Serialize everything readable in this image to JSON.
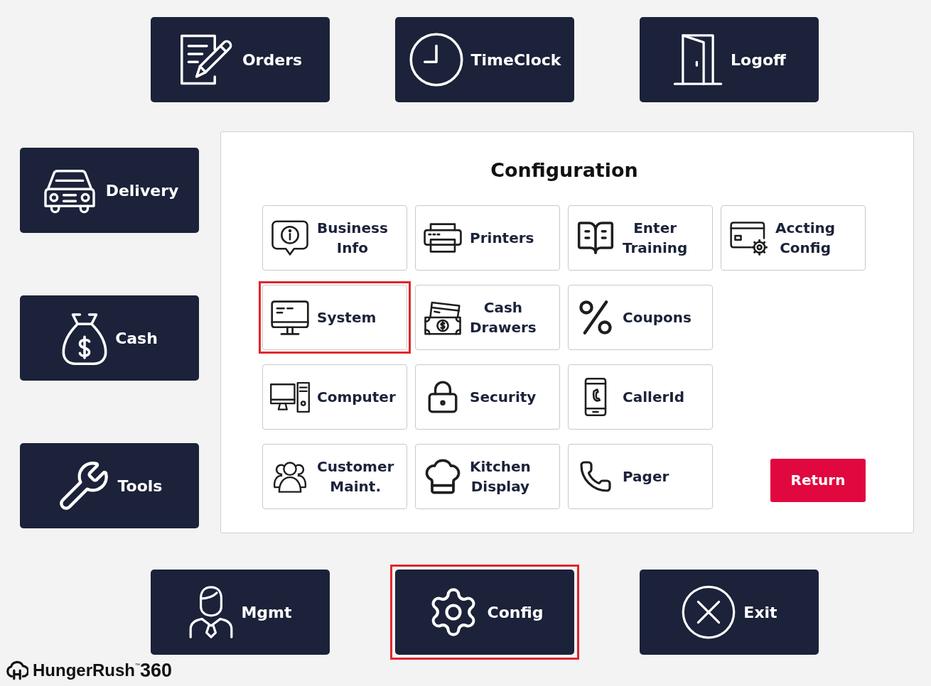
{
  "top_buttons": [
    {
      "label": "Orders"
    },
    {
      "label": "TimeClock"
    },
    {
      "label": "Logoff"
    }
  ],
  "side_buttons": [
    {
      "label": "Delivery"
    },
    {
      "label": "Cash"
    },
    {
      "label": "Tools"
    }
  ],
  "config_panel": {
    "title": "Configuration",
    "tile_rows": [
      [
        {
          "label": "Business Info",
          "highlighted": false
        },
        {
          "label": "Printers",
          "highlighted": false
        },
        {
          "label": "Enter Training",
          "highlighted": false
        },
        {
          "label": "Accting Config",
          "highlighted": false
        }
      ],
      [
        {
          "label": "System",
          "highlighted": true
        },
        {
          "label": "Cash Drawers",
          "highlighted": false
        },
        {
          "label": "Coupons",
          "highlighted": false
        }
      ],
      [
        {
          "label": "Computer",
          "highlighted": false
        },
        {
          "label": "Security",
          "highlighted": false
        },
        {
          "label": "CallerId",
          "highlighted": false
        }
      ],
      [
        {
          "label": "Customer Maint.",
          "highlighted": false
        },
        {
          "label": "Kitchen Display",
          "highlighted": false
        },
        {
          "label": "Pager",
          "highlighted": false
        }
      ]
    ],
    "return_button": {
      "label": "Return"
    }
  },
  "bottom_buttons": [
    {
      "label": "Mgmt",
      "highlighted": false
    },
    {
      "label": "Config",
      "highlighted": true
    },
    {
      "label": "Exit",
      "highlighted": false
    }
  ],
  "logo": {
    "name": "HungerRush",
    "trademark": "™",
    "suffix": "360"
  }
}
